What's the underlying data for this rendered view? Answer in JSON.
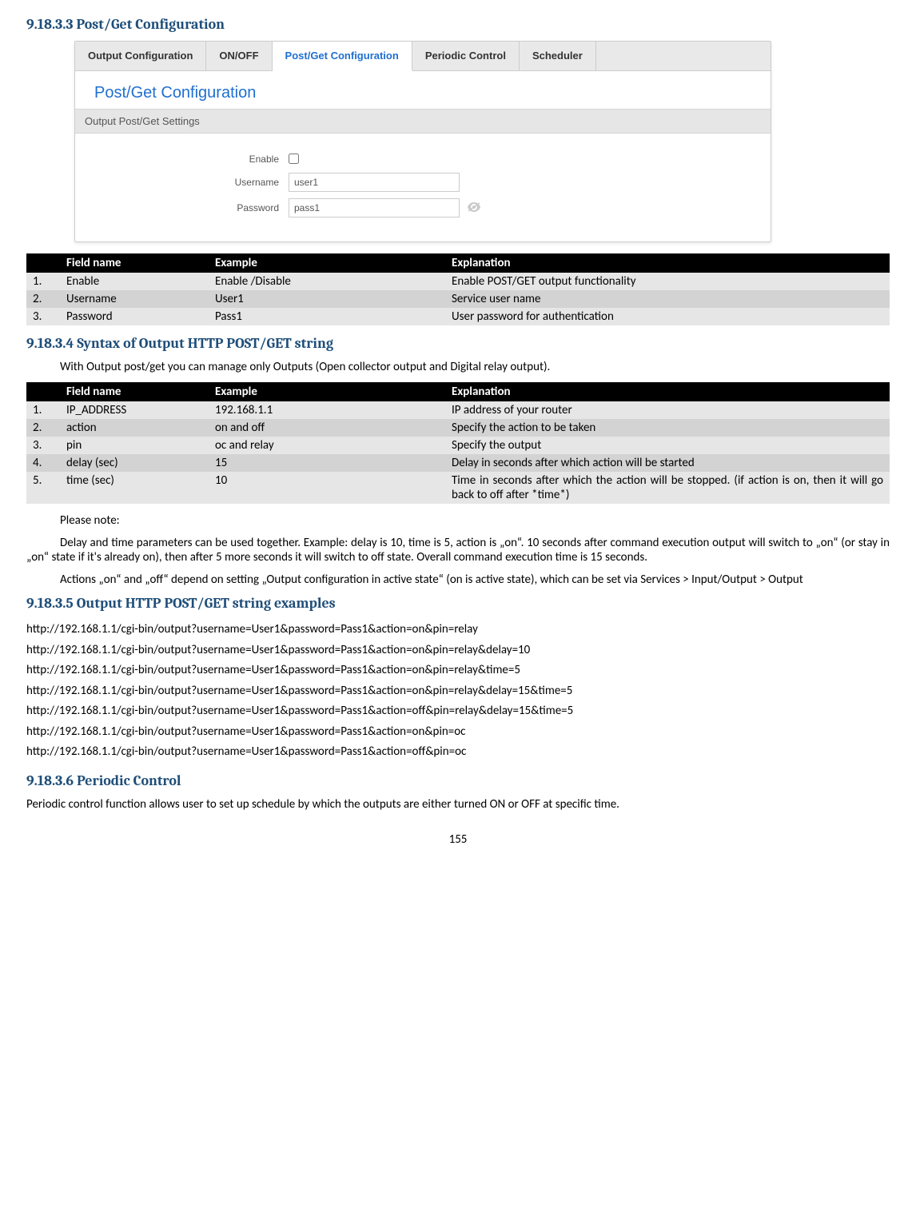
{
  "headings": {
    "s1": "9.18.3.3 Post/Get Configuration",
    "s2": "9.18.3.4 Syntax of Output HTTP POST/GET string",
    "s3": "9.18.3.5 Output HTTP POST/GET string examples",
    "s4": "9.18.3.6 Periodic Control"
  },
  "screenshot": {
    "tabs": {
      "output_config": "Output Configuration",
      "onoff": "ON/OFF",
      "postget": "Post/Get Configuration",
      "periodic": "Periodic Control",
      "scheduler": "Scheduler"
    },
    "panel_title": "Post/Get Configuration",
    "section_bar": "Output Post/Get Settings",
    "form": {
      "enable_label": "Enable",
      "username_label": "Username",
      "username_value": "user1",
      "password_label": "Password",
      "password_value": "pass1"
    }
  },
  "tableHeaders": {
    "num": "",
    "field": "Field name",
    "example": "Example",
    "explanation": "Explanation"
  },
  "table1": [
    {
      "n": "1.",
      "field": "Enable",
      "example": "Enable /Disable",
      "expl": "Enable POST/GET output functionality"
    },
    {
      "n": "2.",
      "field": "Username",
      "example": "User1",
      "expl": "Service user name"
    },
    {
      "n": "3.",
      "field": "Password",
      "example": "Pass1",
      "expl": "User password for authentication"
    }
  ],
  "para1": "With Output post/get you can manage only Outputs (Open collector output and Digital relay output).",
  "table2": [
    {
      "n": "1.",
      "field": "IP_ADDRESS",
      "example": "192.168.1.1",
      "expl": "IP address of your router"
    },
    {
      "n": "2.",
      "field": "action",
      "example": "on and off",
      "expl": "Specify the action to be taken"
    },
    {
      "n": "3.",
      "field": "pin",
      "example": "oc and relay",
      "expl": "Specify the output"
    },
    {
      "n": "4.",
      "field": "delay (sec)",
      "example": "15",
      "expl": "Delay in seconds after which action will be started"
    },
    {
      "n": "5.",
      "field": "time (sec)",
      "example": "10",
      "expl": "Time in seconds after which the action will be stopped. (if action is on, then it will go back to off after *time*)"
    }
  ],
  "notes": {
    "please_note": "Please note:",
    "p2": "Delay and time parameters can be used together. Example: delay is 10, time is 5, action is „on“. 10 seconds after command execution output will switch to „on“ (or stay in „on“ state if it's already on), then after 5 more seconds it will switch to off state. Overall command execution time is 15 seconds.",
    "p3": "Actions „on“ and „off“ depend on setting „Output configuration in active state“ (on is active state), which can be set via Services > Input/Output > Output"
  },
  "urls": [
    "http://192.168.1.1/cgi-bin/output?username=User1&password=Pass1&action=on&pin=relay",
    "http://192.168.1.1/cgi-bin/output?username=User1&password=Pass1&action=on&pin=relay&delay=10",
    "http://192.168.1.1/cgi-bin/output?username=User1&password=Pass1&action=on&pin=relay&time=5",
    "http://192.168.1.1/cgi-bin/output?username=User1&password=Pass1&action=on&pin=relay&delay=15&time=5",
    "http://192.168.1.1/cgi-bin/output?username=User1&password=Pass1&action=off&pin=relay&delay=15&time=5",
    "http://192.168.1.1/cgi-bin/output?username=User1&password=Pass1&action=on&pin=oc",
    "http://192.168.1.1/cgi-bin/output?username=User1&password=Pass1&action=off&pin=oc"
  ],
  "periodic_text": "Periodic control function allows user to set up schedule by which the outputs are either turned ON or OFF at specific time.",
  "page_number": "155"
}
